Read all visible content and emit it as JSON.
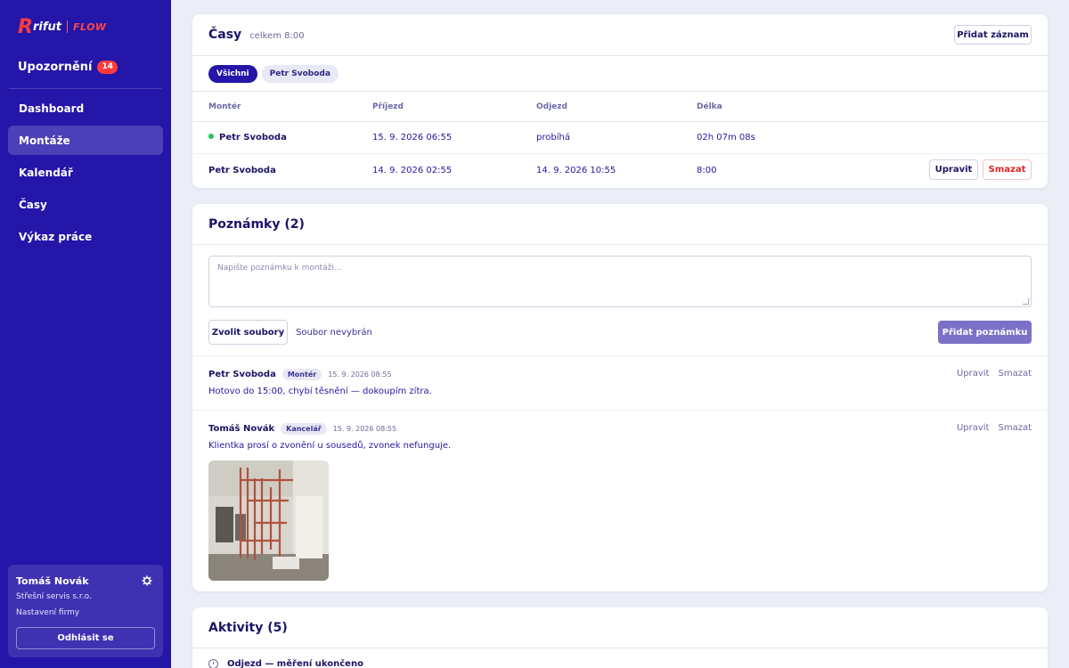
{
  "app": {
    "logo_main": "rifut",
    "logo_sub": "FLOW"
  },
  "sidebar": {
    "notifications": {
      "label": "Upozornění",
      "count": "14"
    },
    "nav": [
      {
        "label": "Dashboard",
        "active": false
      },
      {
        "label": "Montáže",
        "active": true
      },
      {
        "label": "Kalendář",
        "active": false
      },
      {
        "label": "Časy",
        "active": false
      },
      {
        "label": "Výkaz práce",
        "active": false
      }
    ],
    "user": {
      "name": "Tomáš Novák",
      "company": "Střešní servis s.r.o.",
      "settings_link": "Nastavení firmy",
      "logout_label": "Odhlásit se"
    }
  },
  "times": {
    "title": "Časy",
    "total": "celkem 8:00",
    "add_button": "Přidat záznam",
    "filters": [
      "Všichni",
      "Petr Svoboda"
    ],
    "columns": [
      "Montér",
      "Příjezd",
      "Odjezd",
      "Délka"
    ],
    "rows": [
      {
        "worker": "Petr Svoboda",
        "arrival": "15. 9. 2026 06:55",
        "departure": "probíhá",
        "duration": "02h 07m 08s",
        "live": true
      },
      {
        "worker": "Petr Svoboda",
        "arrival": "14. 9. 2026 02:55",
        "departure": "14. 9. 2026 10:55",
        "duration": "8:00",
        "live": false
      }
    ],
    "edit_label": "Upravit",
    "delete_label": "Smazat"
  },
  "notes": {
    "title": "Poznámky (2)",
    "placeholder": "Napište poznámku k montáži...",
    "choose_files": "Zvolit soubory",
    "no_file": "Soubor nevybrán",
    "add_note": "Přidat poznámku",
    "edit_label": "Upravit",
    "delete_label": "Smazat",
    "items": [
      {
        "author": "Petr Svoboda",
        "role": "Montér",
        "time": "15. 9. 2026 08:55",
        "text": "Hotovo do 15:00, chybí těsnění — dokoupím zítra.",
        "has_photo": false
      },
      {
        "author": "Tomáš Novák",
        "role": "Kancelář",
        "time": "15. 9. 2026 08:55",
        "text": "Klientka prosí o zvonění u sousedů, zvonek nefunguje.",
        "has_photo": true
      }
    ]
  },
  "activities": {
    "title": "Aktivity (5)",
    "first_item": "Odjezd — měření ukončeno"
  }
}
